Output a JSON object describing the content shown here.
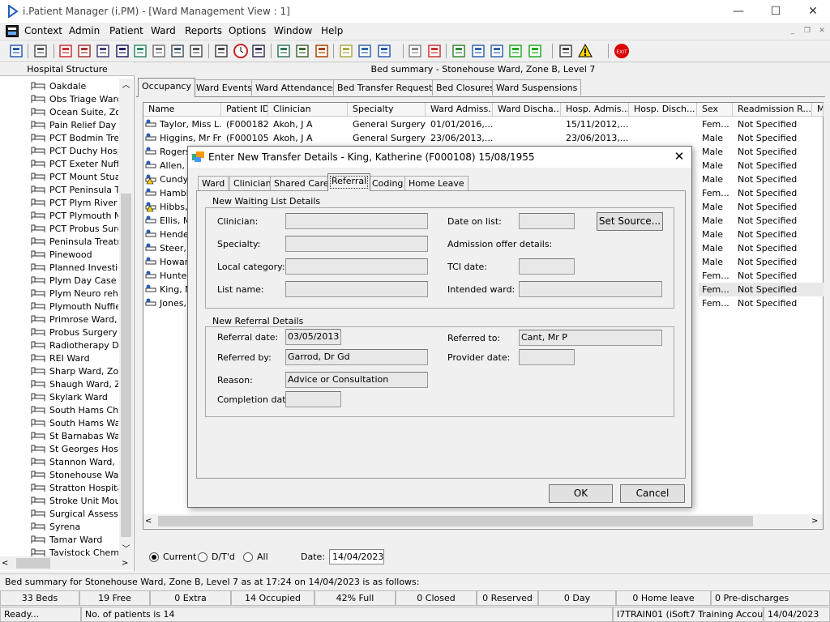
{
  "app": {
    "title": "i.Patient Manager (i.PM) - [Ward Management View : 1]",
    "window_buttons": [
      "—",
      "☐",
      "✕"
    ],
    "mdi_buttons": [
      "_",
      "❐",
      "✕"
    ]
  },
  "menu": [
    "Context",
    "Admin",
    "Patient",
    "Ward",
    "Reports",
    "Options",
    "Window",
    "Help"
  ],
  "toolbar_icons": [
    "user-icon",
    "printer-icon",
    "book-red-icon",
    "book-edit-icon",
    "document-list-icon",
    "medical-m-icon",
    "patient-icon",
    "notepad-icon",
    "ambulance-icon",
    "vehicle-icon",
    "search-doc-icon",
    "clock-icon",
    "monitor-icon",
    "card-icon",
    "card-edit-icon",
    "disc-icon",
    "notes-icon",
    "bed-icon",
    "patient-transfer-icon",
    "document-icon",
    "chart-icon",
    "globe-icon",
    "check-list-icon",
    "check-edit-icon",
    "arrow-green-icon",
    "arrow-refresh-icon",
    "tools-icon",
    "warning-icon",
    "exit-icon"
  ],
  "left_panel": {
    "header": "Hospital Structure",
    "items": [
      "Oakdale",
      "Obs Triage Ward",
      "Ocean Suite, Zor",
      "Pain Relief Day C",
      "PCT Bodmin Trea",
      "PCT Duchy Hosp",
      "PCT Exeter Nuffie",
      "PCT Mount Stuar",
      "PCT Peninsula Tr",
      "PCT Plym River F",
      "PCT Plymouth Nu",
      "PCT Probus Surg",
      "Peninsula Treatm",
      "Pinewood",
      "Planned Investig",
      "Plym Day Case U",
      "Plym Neuro rehab",
      "Plymouth Nuffield",
      "Primrose Ward, Z",
      "Probus Surgery V",
      "Radiotherapy Day",
      "REI Ward",
      "Sharp Ward, Zon",
      "Shaugh Ward, Zo",
      "Skylark Ward",
      "South Hams Cher",
      "South Hams War",
      "St Barnabas War",
      "St Georges Hosp",
      "Stannon Ward, Z",
      "Stonehouse Ward",
      "Stratton Hospital",
      "Stroke Unit Mour",
      "Surgical Assessm",
      "Syrena",
      "Tamar Ward",
      "Tavistock Chemo"
    ]
  },
  "main": {
    "header": "Bed summary - Stonehouse Ward, Zone B, Level 7",
    "tabs": [
      "Occupancy",
      "Ward Events",
      "Ward Attendances",
      "Bed Transfer Requests",
      "Bed Closures",
      "Ward Suspensions"
    ],
    "columns": [
      "Name",
      "Patient ID",
      "Clinician",
      "Specialty",
      "Ward Admiss...",
      "Ward Discha...",
      "Hosp. Admis...",
      "Hosp. Disch...",
      "Sex",
      "Readmission R...",
      "M"
    ],
    "rows": [
      {
        "name": "Taylor, Miss L...",
        "id": "(F000182)",
        "clinician": "Akoh, J A",
        "specialty": "General Surgery",
        "ward_adm": "01/01/2016,...",
        "hosp_adm": "15/11/2012,...",
        "sex": "Fem...",
        "readm": "Not Specified"
      },
      {
        "name": "Higgins, Mr Fr...",
        "id": "(F000105)",
        "clinician": "Akoh, J A",
        "specialty": "General Surgery",
        "ward_adm": "23/06/2013,...",
        "hosp_adm": "23/06/2013,...",
        "sex": "Male",
        "readm": "Not Specified"
      },
      {
        "name": "Rogers",
        "sex": "Male",
        "readm": "Not Specified"
      },
      {
        "name": "Allen, M",
        "sex": "Male",
        "readm": "Not Specified"
      },
      {
        "name": "Cundy,",
        "sex": "Male",
        "readm": "Not Specified"
      },
      {
        "name": "Hamble",
        "sex": "Fem...",
        "readm": "Not Specified"
      },
      {
        "name": "Hibbs,",
        "sex": "Male",
        "readm": "Not Specified"
      },
      {
        "name": "Ellis, M",
        "sex": "Male",
        "readm": "Not Specified"
      },
      {
        "name": "Hender",
        "sex": "Male",
        "readm": "Not Specified"
      },
      {
        "name": "Steer, M",
        "sex": "Male",
        "readm": "Not Specified"
      },
      {
        "name": "Howard",
        "sex": "Male",
        "readm": "Not Specified"
      },
      {
        "name": "Hunter,",
        "sex": "Fem...",
        "readm": "Not Specified"
      },
      {
        "name": "King, M",
        "sex": "Fem...",
        "readm": "Not Specified"
      },
      {
        "name": "Jones,",
        "sex": "Fem...",
        "readm": "Not Specified"
      }
    ],
    "filter": {
      "current": "Current",
      "dtd": "D/T'd",
      "all": "All",
      "date_label": "Date:",
      "date_value": "14/04/2023"
    }
  },
  "status": {
    "line": "Bed summary for Stonehouse Ward, Zone B, Level 7 as at 17:24 on 14/04/2023 is as follows:",
    "cells": [
      "33 Beds",
      "19 Free",
      "0 Extra",
      "14 Occupied",
      "42% Full",
      "0 Closed",
      "0 Reserved",
      "0 Day",
      "0 Home leave",
      "0 Pre-discharges"
    ],
    "ready": "Ready...",
    "patients": "No. of patients is 14",
    "account": "I7TRAIN01 (iSoft7 Training Account)",
    "date": "14/04/2023"
  },
  "dialog": {
    "title": "Enter New Transfer Details - King, Katherine (F000108) 15/08/1955",
    "tabs": [
      "Ward",
      "Clinician",
      "Shared Care",
      "Referral",
      "Coding",
      "Home Leave"
    ],
    "waiting": {
      "legend": "New Waiting List Details",
      "clinician_label": "Clinician:",
      "specialty_label": "Specialty:",
      "local_category_label": "Local category:",
      "list_name_label": "List name:",
      "date_on_list_label": "Date on list:",
      "set_source": "Set Source...",
      "admission_offer_label": "Admission offer details:",
      "tci_date_label": "TCI date:",
      "intended_ward_label": "Intended ward:"
    },
    "referral": {
      "legend": "New Referral Details",
      "referral_date_label": "Referral date:",
      "referral_date": "03/05/2013",
      "referred_by_label": "Referred by:",
      "referred_by": "Garrod, Dr Gd",
      "reason_label": "Reason:",
      "reason": "Advice or Consultation",
      "completion_date_label": "Completion date:",
      "referred_to_label": "Referred to:",
      "referred_to": "Cant, Mr P",
      "provider_date_label": "Provider date:"
    },
    "ok": "OK",
    "cancel": "Cancel"
  }
}
